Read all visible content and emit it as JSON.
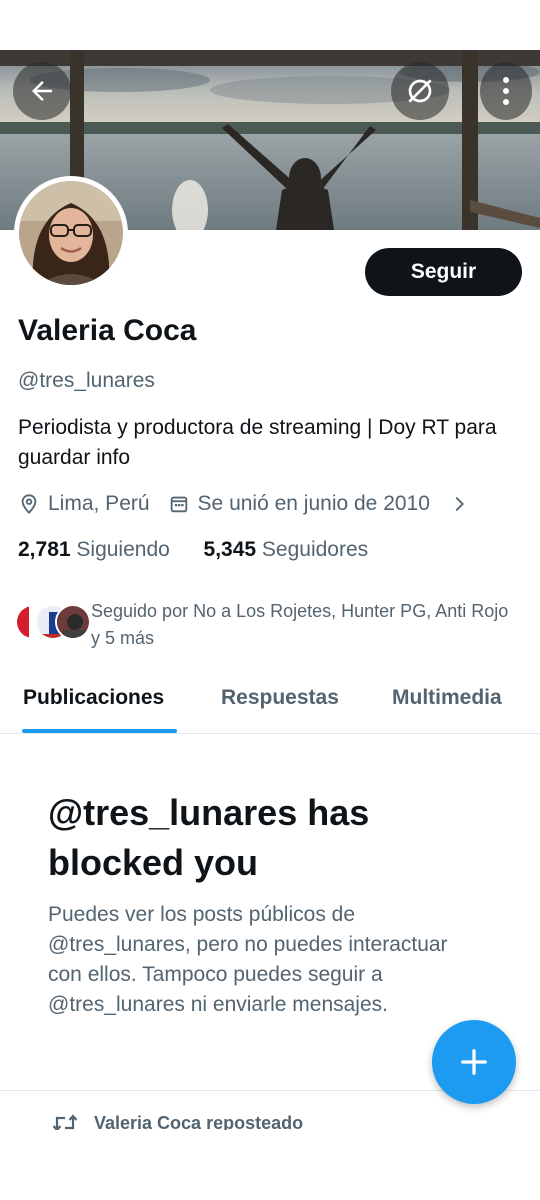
{
  "header": {
    "back_icon": "arrow-left-icon",
    "sync_icon": "sync-off-icon",
    "more_icon": "more-vertical-icon"
  },
  "profile": {
    "name": "Valeria Coca",
    "handle": "@tres_lunares",
    "bio": "Periodista y productora de streaming | Doy RT para guardar info",
    "location": "Lima, Perú",
    "joined": "Se unió en junio de 2010",
    "following_count": "2,781",
    "following_label": "Siguiendo",
    "followers_count": "5,345",
    "followers_label": "Seguidores",
    "followed_by": "Seguido por No a Los Rojetes, Hunter PG, Anti Rojo y 5 más",
    "follow_button": "Seguir"
  },
  "tabs": [
    {
      "label": "Publicaciones",
      "active": true
    },
    {
      "label": "Respuestas",
      "active": false
    },
    {
      "label": "Multimedia",
      "active": false
    }
  ],
  "blocked": {
    "title": "@tres_lunares has blocked you",
    "body": "Puedes ver los posts públicos de @tres_lunares, pero no puedes interactuar con ellos. Tampoco puedes seguir a @tres_lunares ni enviarle mensajes."
  },
  "feed": {
    "repost_text": "Valeria Coca reposteado"
  },
  "colors": {
    "accent": "#1d9bf0",
    "text_primary": "#0f1419",
    "text_secondary": "#536471",
    "button_dark": "#0f1419"
  }
}
